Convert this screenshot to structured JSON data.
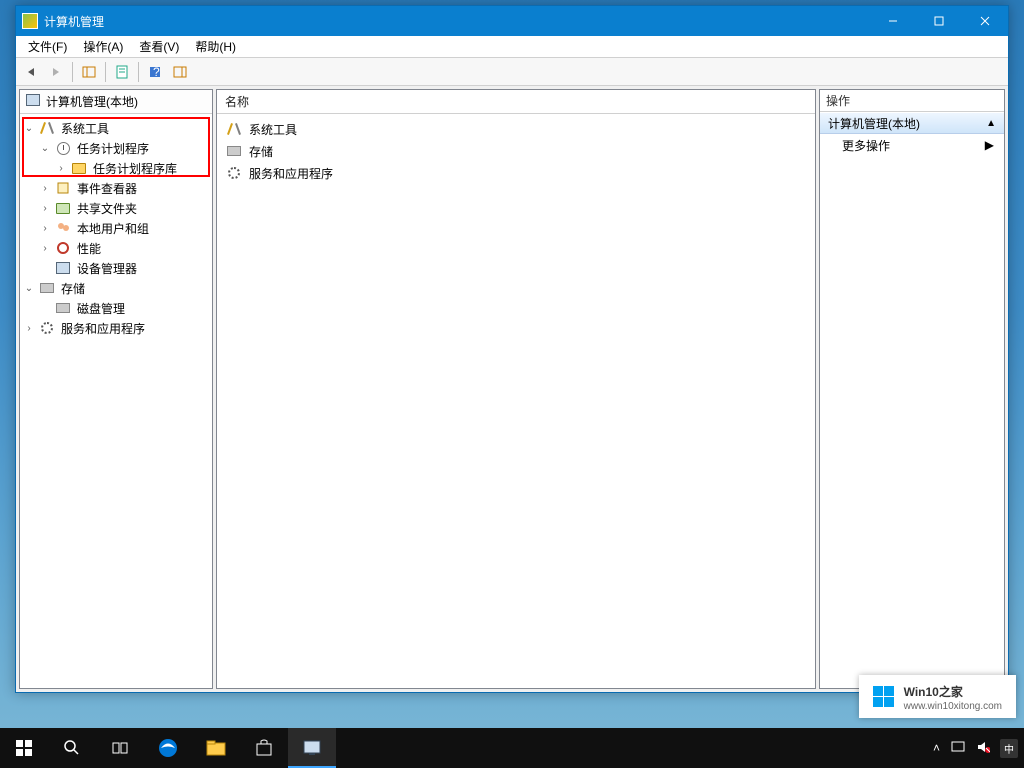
{
  "window": {
    "title": "计算机管理"
  },
  "menus": {
    "file": "文件(F)",
    "action": "操作(A)",
    "view": "查看(V)",
    "help": "帮助(H)"
  },
  "tree": {
    "root": "计算机管理(本地)",
    "system_tools": "系统工具",
    "task_scheduler": "任务计划程序",
    "task_scheduler_library": "任务计划程序库",
    "event_viewer": "事件查看器",
    "shared_folders": "共享文件夹",
    "local_users_groups": "本地用户和组",
    "performance": "性能",
    "device_manager": "设备管理器",
    "storage": "存储",
    "disk_management": "磁盘管理",
    "services_apps": "服务和应用程序"
  },
  "mid": {
    "header": "名称",
    "items": [
      {
        "label": "系统工具",
        "icon": "tools"
      },
      {
        "label": "存储",
        "icon": "disk"
      },
      {
        "label": "服务和应用程序",
        "icon": "gear"
      }
    ]
  },
  "actions": {
    "title": "操作",
    "category": "计算机管理(本地)",
    "more": "更多操作"
  },
  "watermark": {
    "title_en": "Win10",
    "title_zh": "之家",
    "url": "www.win10xitong.com"
  },
  "taskbar": {
    "ime": "中"
  }
}
